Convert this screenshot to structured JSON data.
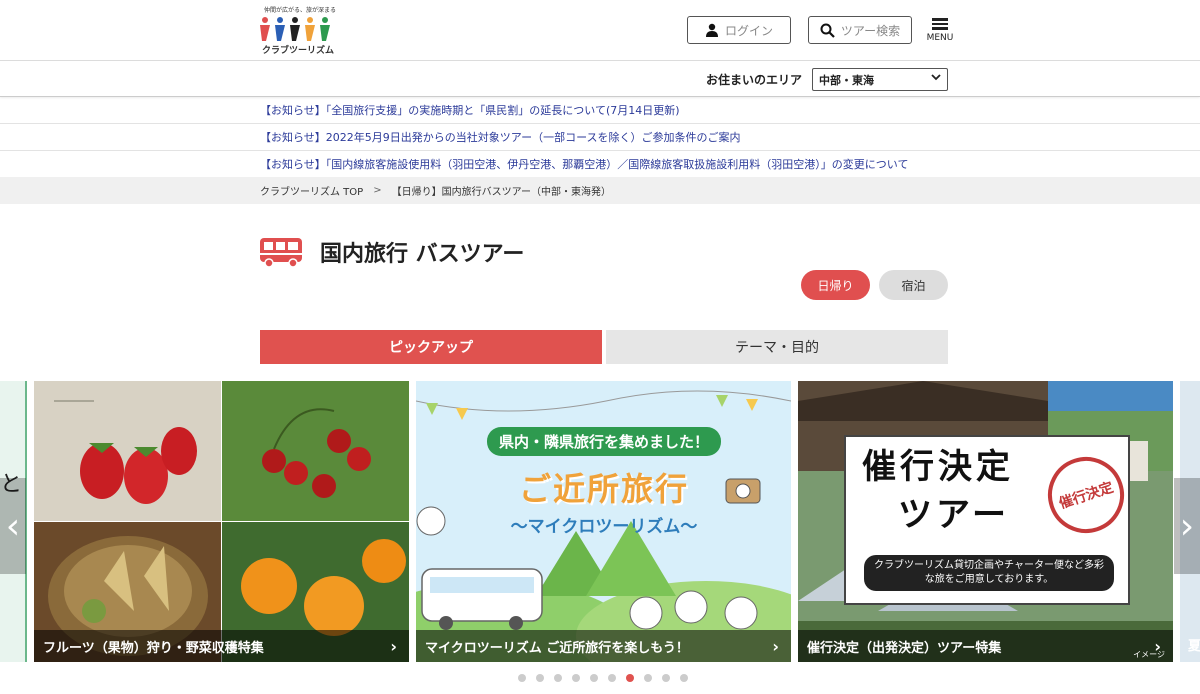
{
  "header": {
    "logo_tagline": "仲間が広がる、旅が深まる",
    "logo_name": "クラブツーリズム",
    "login_label": "ログイン",
    "search_label": "ツアー検索",
    "menu_label": "MENU"
  },
  "area": {
    "label": "お住まいのエリア",
    "selected": "中部・東海"
  },
  "notices": [
    "【お知らせ】「全国旅行支援」の実施時期と「県民割」の延長について(7月14日更新)",
    "【お知らせ】2022年5月9日出発からの当社対象ツアー（一部コースを除く）ご参加条件のご案内",
    "【お知らせ】「国内線旅客施設使用料（羽田空港、伊丹空港、那覇空港）／国際線旅客取扱施設利用料（羽田空港）」の変更について"
  ],
  "breadcrumb": {
    "home": "クラブツーリズム TOP",
    "separator": ">",
    "current": "【日帰り】国内旅行バスツアー（中部・東海発）"
  },
  "page": {
    "title": "国内旅行 バスツアー",
    "pill_day": "日帰り",
    "pill_stay": "宿泊"
  },
  "tabs": {
    "pickup": "ピックアップ",
    "theme": "テーマ・目的"
  },
  "carousel": {
    "left_partial_text": "と",
    "cards": [
      {
        "caption": "フルーツ（果物）狩り・野菜収穫特集"
      },
      {
        "caption": "マイクロツーリズム ご近所旅行を楽しもう！",
        "headline": "県内・隣県旅行を集めました！",
        "title": "ご近所旅行",
        "subtitle": "〜マイクロツーリズム〜"
      },
      {
        "caption": "催行決定（出発決定）ツアー特集",
        "title_line1": "催行決定",
        "title_line2": "ツアー",
        "stamp": "催行決定",
        "desc": "クラブツーリズム貸切企画やチャーター便など多彩な旅をご用意しております。",
        "image_note": "イメージ"
      }
    ],
    "right_partial_caption": "夏",
    "dots_total": 10,
    "dots_active_index": 6
  },
  "colors": {
    "accent": "#e0524f",
    "link": "#2b3a99"
  }
}
